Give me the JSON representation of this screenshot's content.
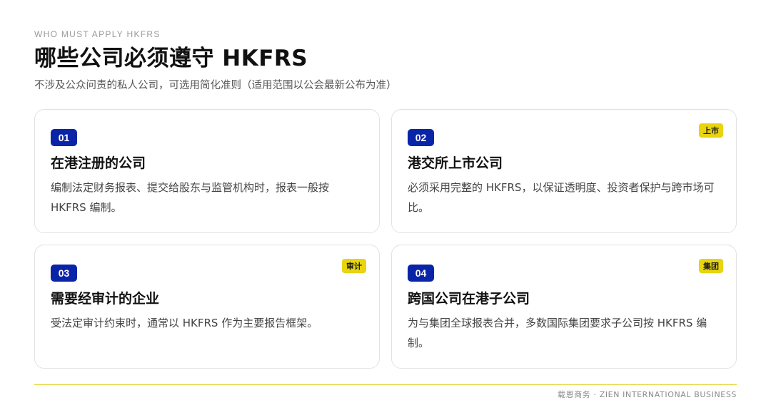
{
  "header": {
    "eyebrow": "WHO MUST APPLY HKFRS",
    "title": "哪些公司必须遵守 HKFRS",
    "subtitle": "不涉及公众问责的私人公司，可选用简化准则（适用范围以公会最新公布为准）"
  },
  "cards": [
    {
      "number": "01",
      "tag": "",
      "title": "在港注册的公司",
      "description": "编制法定财务报表、提交给股东与监管机构时，报表一般按 HKFRS 编制。"
    },
    {
      "number": "02",
      "tag": "上市",
      "title": "港交所上市公司",
      "description": "必须采用完整的 HKFRS，以保证透明度、投资者保护与跨市场可比。"
    },
    {
      "number": "03",
      "tag": "审计",
      "title": "需要经审计的企业",
      "description": "受法定审计约束时，通常以 HKFRS 作为主要报告框架。"
    },
    {
      "number": "04",
      "tag": "集团",
      "title": "跨国公司在港子公司",
      "description": "为与集团全球报表合并，多数国际集团要求子公司按 HKFRS 编制。"
    }
  ],
  "footer": {
    "text": "载恩商务 · ZIEN INTERNATIONAL BUSINESS"
  },
  "colors": {
    "badge_blue": "#0a24a8",
    "tag_yellow": "#e8d40f",
    "rule_yellow": "#e6d63a"
  }
}
